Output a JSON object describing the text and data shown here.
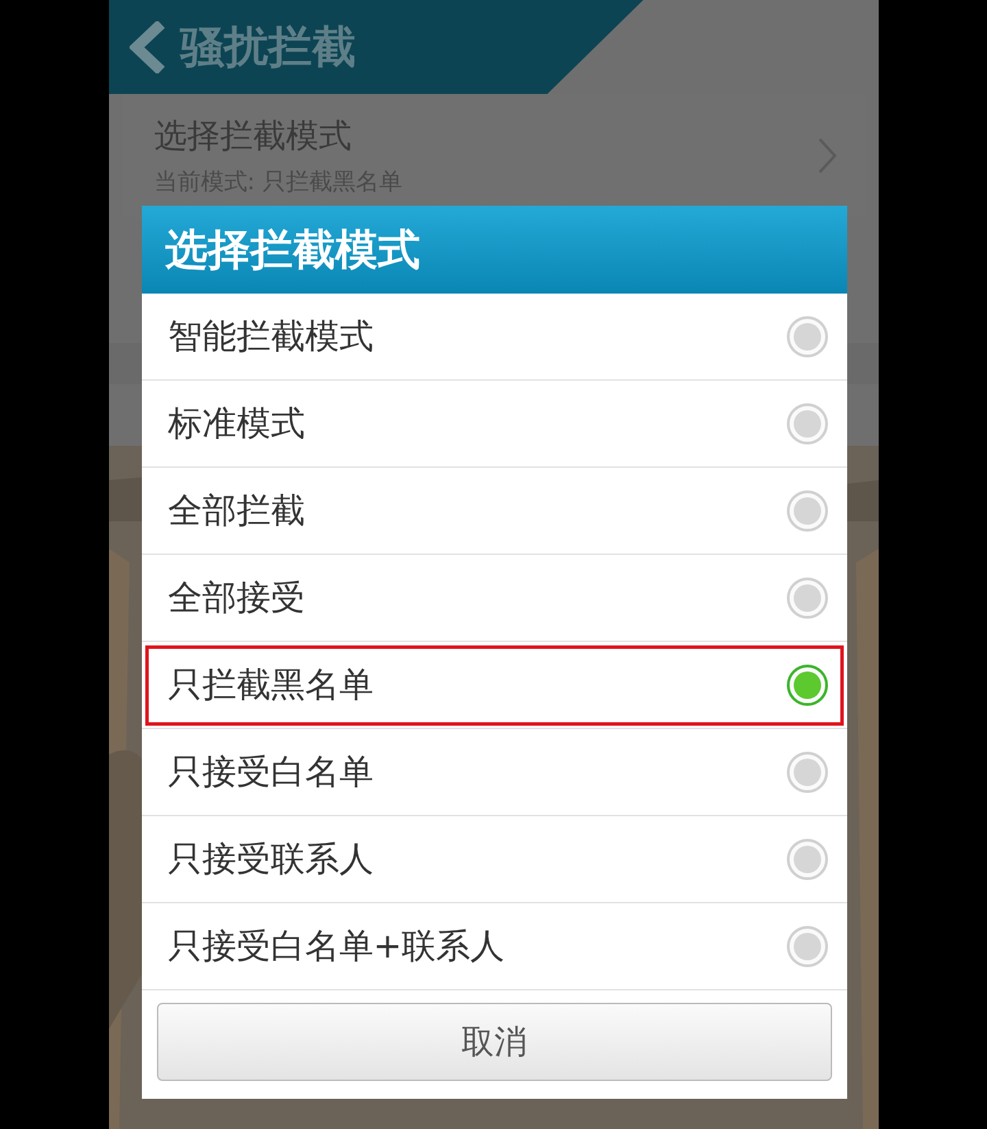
{
  "header": {
    "title": "骚扰拦截"
  },
  "setting": {
    "title": "选择拦截模式",
    "subtitle": "当前模式: 只拦截黑名单"
  },
  "dialog": {
    "title": "选择拦截模式",
    "options": [
      {
        "label": "智能拦截模式",
        "selected": false,
        "highlighted": false
      },
      {
        "label": "标准模式",
        "selected": false,
        "highlighted": false
      },
      {
        "label": "全部拦截",
        "selected": false,
        "highlighted": false
      },
      {
        "label": "全部接受",
        "selected": false,
        "highlighted": false
      },
      {
        "label": "只拦截黑名单",
        "selected": true,
        "highlighted": true
      },
      {
        "label": "只接受白名单",
        "selected": false,
        "highlighted": false
      },
      {
        "label": "只接受联系人",
        "selected": false,
        "highlighted": false
      },
      {
        "label": "只接受白名单+联系人",
        "selected": false,
        "highlighted": false
      }
    ],
    "cancel": "取消"
  }
}
